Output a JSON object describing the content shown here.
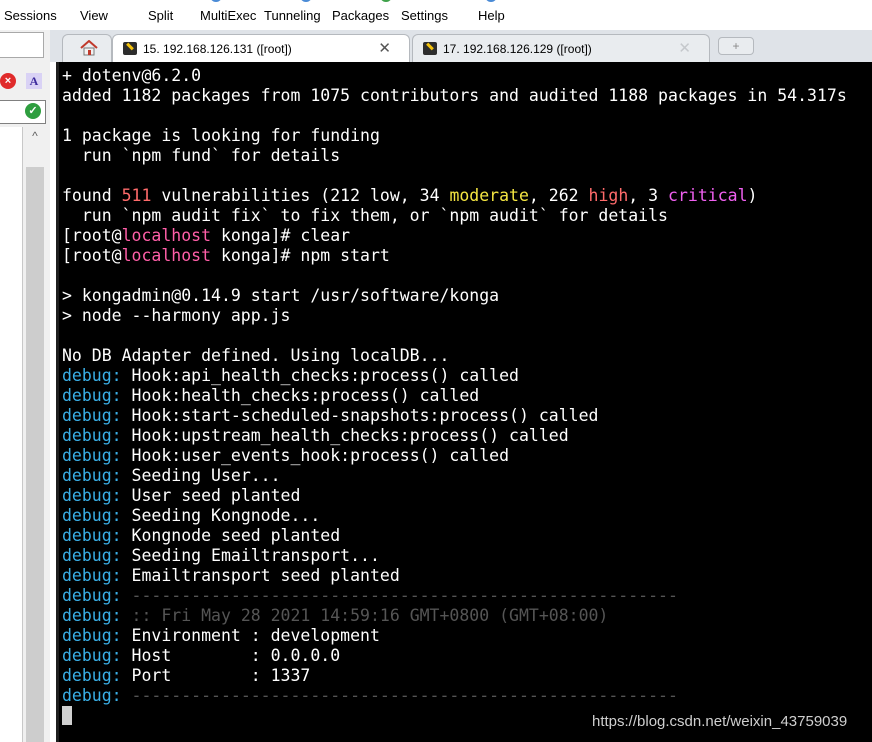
{
  "menu": {
    "items": [
      "Sessions",
      "View",
      "Split",
      "MultiExec",
      "Tunneling",
      "Packages",
      "Settings",
      "Help"
    ]
  },
  "side_panel": {
    "red_icon": "×",
    "font_icon": "A",
    "check_icon": "✓",
    "scroll_up": "^"
  },
  "tabs": [
    {
      "label": "15. 192.168.126.131 ([root])",
      "close": "✕",
      "active": true
    },
    {
      "label": "17. 192.168.126.129 ([root])",
      "close": "✕",
      "active": false
    }
  ],
  "add_tab": "+",
  "terminal": {
    "lines": [
      [
        {
          "t": "+ dotenv@6.2.0",
          "c": "white"
        }
      ],
      [
        {
          "t": "added 1182 packages from 1075 contributors and audited 1188 packages in 54.317s",
          "c": "white"
        }
      ],
      [],
      [
        {
          "t": "1 package is looking for funding",
          "c": "white"
        }
      ],
      [
        {
          "t": "  run `npm fund` for details",
          "c": "white"
        }
      ],
      [],
      [
        {
          "t": "found ",
          "c": "white"
        },
        {
          "t": "511",
          "c": "red"
        },
        {
          "t": " vulnerabilities (212 low, 34 ",
          "c": "white"
        },
        {
          "t": "moderate",
          "c": "yellow"
        },
        {
          "t": ", 262 ",
          "c": "white"
        },
        {
          "t": "high",
          "c": "red"
        },
        {
          "t": ", 3 ",
          "c": "white"
        },
        {
          "t": "critical",
          "c": "magenta"
        },
        {
          "t": ")",
          "c": "white"
        }
      ],
      [
        {
          "t": "  run `npm audit fix` to fix them, or `npm audit` for details",
          "c": "white"
        }
      ],
      [
        {
          "t": "[root@",
          "c": "white"
        },
        {
          "t": "localhost",
          "c": "pink"
        },
        {
          "t": " konga]# clear",
          "c": "white"
        }
      ],
      [
        {
          "t": "[root@",
          "c": "white"
        },
        {
          "t": "localhost",
          "c": "pink"
        },
        {
          "t": " konga]# npm start",
          "c": "white"
        }
      ],
      [],
      [
        {
          "t": "> kongadmin@0.14.9 start /usr/software/konga",
          "c": "white"
        }
      ],
      [
        {
          "t": "> node --harmony app.js",
          "c": "white"
        }
      ],
      [],
      [
        {
          "t": "No DB Adapter defined. Using localDB...",
          "c": "white"
        }
      ],
      [
        {
          "t": "debug:",
          "c": "debug"
        },
        {
          "t": " Hook:api_health_checks:process() called",
          "c": "white"
        }
      ],
      [
        {
          "t": "debug:",
          "c": "debug"
        },
        {
          "t": " Hook:health_checks:process() called",
          "c": "white"
        }
      ],
      [
        {
          "t": "debug:",
          "c": "debug"
        },
        {
          "t": " Hook:start-scheduled-snapshots:process() called",
          "c": "white"
        }
      ],
      [
        {
          "t": "debug:",
          "c": "debug"
        },
        {
          "t": " Hook:upstream_health_checks:process() called",
          "c": "white"
        }
      ],
      [
        {
          "t": "debug:",
          "c": "debug"
        },
        {
          "t": " Hook:user_events_hook:process() called",
          "c": "white"
        }
      ],
      [
        {
          "t": "debug:",
          "c": "debug"
        },
        {
          "t": " Seeding User...",
          "c": "white"
        }
      ],
      [
        {
          "t": "debug:",
          "c": "debug"
        },
        {
          "t": " User seed planted",
          "c": "white"
        }
      ],
      [
        {
          "t": "debug:",
          "c": "debug"
        },
        {
          "t": " Seeding Kongnode...",
          "c": "white"
        }
      ],
      [
        {
          "t": "debug:",
          "c": "debug"
        },
        {
          "t": " Kongnode seed planted",
          "c": "white"
        }
      ],
      [
        {
          "t": "debug:",
          "c": "debug"
        },
        {
          "t": " Seeding Emailtransport...",
          "c": "white"
        }
      ],
      [
        {
          "t": "debug:",
          "c": "debug"
        },
        {
          "t": " Emailtransport seed planted",
          "c": "white"
        }
      ],
      [
        {
          "t": "debug:",
          "c": "debug"
        },
        {
          "t": " -------------------------------------------------------",
          "c": "gray"
        }
      ],
      [
        {
          "t": "debug:",
          "c": "debug"
        },
        {
          "t": " :: Fri May 28 2021 14:59:16 GMT+0800 (GMT+08:00)",
          "c": "gray"
        }
      ],
      [
        {
          "t": "debug:",
          "c": "debug"
        },
        {
          "t": " Environment : development",
          "c": "white"
        }
      ],
      [
        {
          "t": "debug:",
          "c": "debug"
        },
        {
          "t": " Host        : 0.0.0.0",
          "c": "white"
        }
      ],
      [
        {
          "t": "debug:",
          "c": "debug"
        },
        {
          "t": " Port        : 1337",
          "c": "white"
        }
      ],
      [
        {
          "t": "debug:",
          "c": "debug"
        },
        {
          "t": " -------------------------------------------------------",
          "c": "gray"
        }
      ]
    ]
  },
  "watermark": "https://blog.csdn.net/weixin_43759039"
}
